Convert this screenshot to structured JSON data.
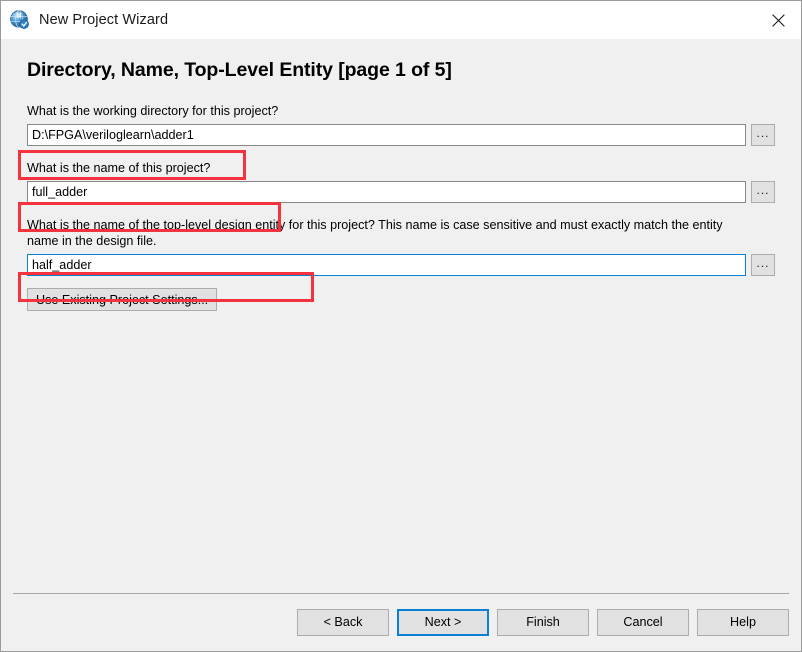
{
  "window": {
    "title": "New Project Wizard",
    "icon": "quartus-globe-icon",
    "close_label": "✕"
  },
  "page": {
    "heading": "Directory, Name, Top-Level Entity [page 1 of 5]"
  },
  "fields": [
    {
      "label": "What is the working directory for this project?",
      "value": "D:\\FPGA\\veriloglearn\\adder1",
      "placeholder": "",
      "focused": false,
      "browse_label": "...",
      "name": "working-directory"
    },
    {
      "label": "What is the name of this project?",
      "value": "full_adder",
      "placeholder": "",
      "focused": false,
      "browse_label": "...",
      "name": "project-name"
    },
    {
      "label": "What is the name of the top-level design entity for this project? This name is case sensitive and must exactly match the entity name in the design file.",
      "value": "half_adder",
      "placeholder": "",
      "focused": true,
      "browse_label": "...",
      "name": "top-level-entity"
    }
  ],
  "use_existing": {
    "label": "Use Existing Project Settings..."
  },
  "footer": {
    "buttons": [
      {
        "label": "< Back",
        "name": "back-button",
        "default": false
      },
      {
        "label": "Next >",
        "name": "next-button",
        "default": true
      },
      {
        "label": "Finish",
        "name": "finish-button",
        "default": false
      },
      {
        "label": "Cancel",
        "name": "cancel-button",
        "default": false
      },
      {
        "label": "Help",
        "name": "help-button",
        "default": false
      }
    ]
  },
  "annotations": {
    "color": "#f5333f",
    "boxes": [
      {
        "target": "working-directory-input"
      },
      {
        "target": "project-name-input"
      },
      {
        "target": "top-level-entity-input"
      }
    ]
  },
  "colors": {
    "accent": "#0a7fd4",
    "annotation": "#f5333f",
    "dialog_bg": "#f0f0f0",
    "titlebar_bg": "#ffffff"
  }
}
